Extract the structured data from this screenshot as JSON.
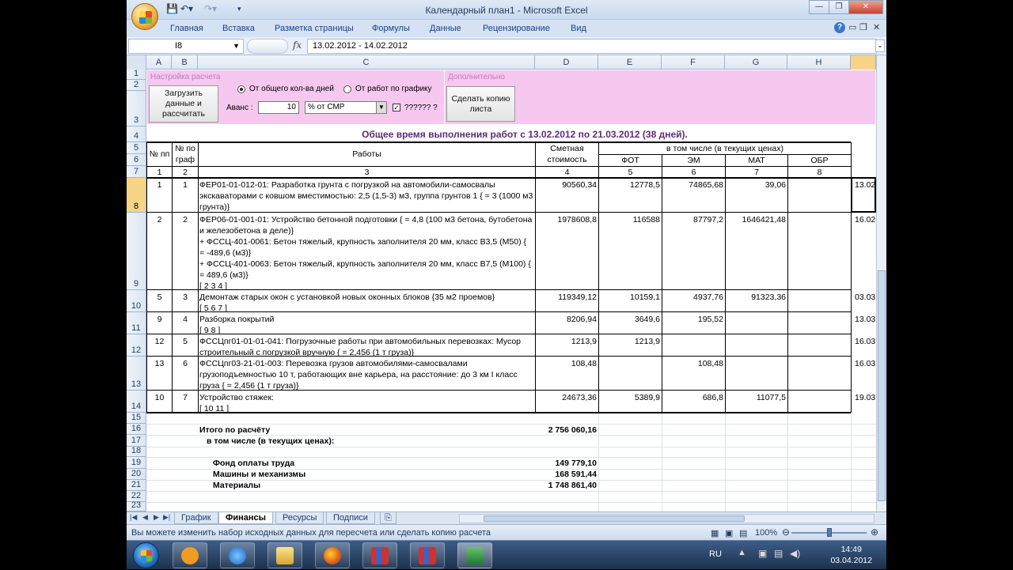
{
  "window": {
    "title": "Календарный план1 - Microsoft Excel"
  },
  "ribbon_tabs": [
    "Главная",
    "Вставка",
    "Разметка страницы",
    "Формулы",
    "Данные",
    "Рецензирование",
    "Вид"
  ],
  "formula_bar": {
    "name_box": "I8",
    "fx": "fx",
    "value": "13.02.2012 - 14.02.2012"
  },
  "columns": [
    "A",
    "B",
    "C",
    "D",
    "E",
    "F",
    "G",
    "H"
  ],
  "panel": {
    "group1": "Настройка расчета",
    "group2": "Дополнительно",
    "load_button": "Загрузить данные и рассчитать",
    "radio1": "От общего кол-ва дней",
    "radio2": "От работ по графику",
    "advance_label": "Аванс :",
    "advance_value": "10",
    "advance_type": "% от СМР",
    "check_label": "?????? ?",
    "copy_button": "Сделать копию листа"
  },
  "summary_title": "Общее время выполнения работ с 13.02.2012 по 21.03.2012 (38 дней).",
  "table_header": {
    "np": "№ пп",
    "graf": "№ по граф",
    "works": "Работы",
    "cost": "Сметная стоимость",
    "incl": "в том числе (в текущих ценах)",
    "fot": "ФОТ",
    "em": "ЭМ",
    "mat": "МАТ",
    "obr": "ОБР",
    "nums": [
      "1",
      "2",
      "3",
      "4",
      "5",
      "6",
      "7",
      "8"
    ]
  },
  "rows": [
    {
      "row": "8",
      "np": "1",
      "graf": "1",
      "text": "ФЕР01-01-012-01: Разработка грунта с погрузкой на автомобили-самосвалы экскаваторами с ковшом вместимостью: 2,5 (1,5-3) м3, группа грунтов 1 { = 3 (1000 м3 грунта)}",
      "cost": "90560,34",
      "fot": "12778,5",
      "em": "74865,68",
      "mat": "39,06",
      "date": "13.02"
    },
    {
      "row": "9",
      "np": "2",
      "graf": "2",
      "text": "ФЕР06-01-001-01: Устройство бетонной подготовки { = 4,8 (100 м3 бетона, бутобетона и железобетона в деле)}\n+ ФССЦ-401-0061: Бетон тяжелый, крупность заполнителя 20 мм, класс В3,5 (М50) { = -489,6 (м3)}\n+ ФССЦ-401-0063: Бетон тяжелый, крупность заполнителя 20 мм, класс В7,5 (М100) { = 489,6 (м3)}\n[ 2 3 4 ]",
      "cost": "1978608,8",
      "fot": "116588",
      "em": "87797,2",
      "mat": "1646421,48",
      "date": "16.02"
    },
    {
      "row": "10",
      "np": "5",
      "graf": "3",
      "text": "Демонтаж старых окон с установкой новых оконных блоков {35 м2 проемов}\n[ 5 6 7 ]",
      "cost": "119349,12",
      "fot": "10159,1",
      "em": "4937,76",
      "mat": "91323,36",
      "date": "03.03"
    },
    {
      "row": "11",
      "np": "9",
      "graf": "4",
      "text": "Разборка покрытий\n[ 9 8 ]",
      "cost": "8206,94",
      "fot": "3649,6",
      "em": "195,52",
      "mat": "",
      "date": "13.03"
    },
    {
      "row": "12",
      "np": "12",
      "graf": "5",
      "text": "ФССЦпг01-01-01-041: Погрузочные работы при автомобильных перевозках: Мусор строительный с погрузкой вручную { = 2,456 (1 т груза)}",
      "cost": "1213,9",
      "fot": "1213,9",
      "em": "",
      "mat": "",
      "date": "16.03"
    },
    {
      "row": "13",
      "np": "13",
      "graf": "6",
      "text": "ФССЦпг03-21-01-003: Перевозка грузов автомобилями-самосвалами грузоподъемностью 10 т, работающих вне карьера, на расстояние: до 3 км I класс груза { = 2,456 (1 т груза)}",
      "cost": "108,48",
      "fot": "",
      "em": "108,48",
      "mat": "",
      "date": "16.03"
    },
    {
      "row": "14",
      "np": "10",
      "graf": "7",
      "text": "Устройство стяжек:\n[ 10 11 ]",
      "cost": "24673,36",
      "fot": "5389,9",
      "em": "686,8",
      "mat": "11077,5",
      "date": "19.03"
    }
  ],
  "totals": {
    "itogo_label": "Итого по расчёту",
    "itogo": "2 756 060,16",
    "incl_label": "в том числе (в текущих ценах):",
    "fot_label": "Фонд оплаты труда",
    "fot": "149 779,10",
    "em_label": "Машины и механизмы",
    "em": "168 591,44",
    "mat_label": "Материалы",
    "mat": "1 748 861,40"
  },
  "sheet_tabs": [
    "График",
    "Финансы",
    "Ресурсы",
    "Подписи"
  ],
  "active_tab": "Финансы",
  "status": {
    "text": "Вы можете изменить набор исходных данных для пересчета или сделать копию расчета",
    "zoom": "100%"
  },
  "taskbar": {
    "lang": "RU",
    "time": "14:49",
    "date": "03.04.2012"
  }
}
